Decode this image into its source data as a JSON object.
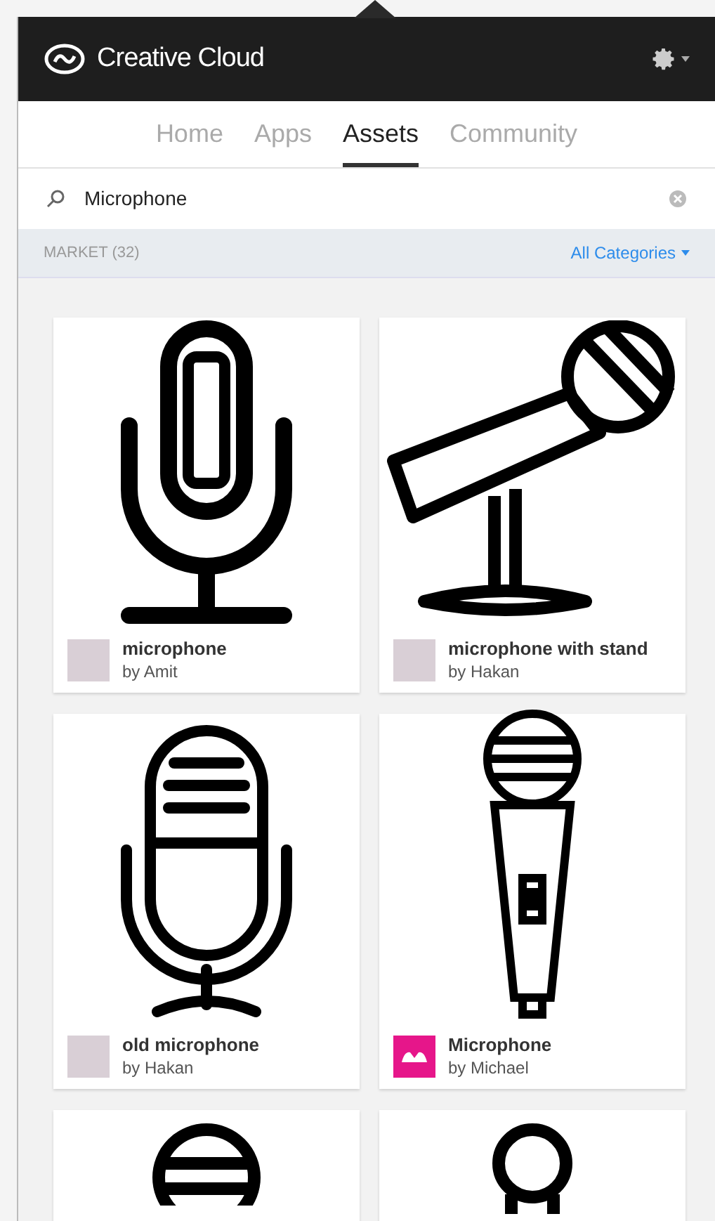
{
  "header": {
    "title": "Creative Cloud"
  },
  "tabs": [
    {
      "label": "Home",
      "selected": false
    },
    {
      "label": "Apps",
      "selected": false
    },
    {
      "label": "Assets",
      "selected": true
    },
    {
      "label": "Community",
      "selected": false
    }
  ],
  "search": {
    "value": "Microphone"
  },
  "market": {
    "label": "MARKET (32)",
    "filter": "All Categories"
  },
  "assets": [
    {
      "kind": "studio",
      "title": "microphone",
      "author": "by Amit",
      "avatar": {
        "kind": "photo"
      }
    },
    {
      "kind": "stand",
      "title": "microphone with stand",
      "author": "by Hakan",
      "avatar": {
        "kind": "photo"
      }
    },
    {
      "kind": "retro",
      "title": "old microphone",
      "author": "by Hakan",
      "avatar": {
        "kind": "photo"
      }
    },
    {
      "kind": "handheld",
      "title": "Microphone",
      "author": "by Michael",
      "avatar": {
        "kind": "logo"
      }
    },
    {
      "kind": "round"
    },
    {
      "kind": "ring"
    }
  ]
}
